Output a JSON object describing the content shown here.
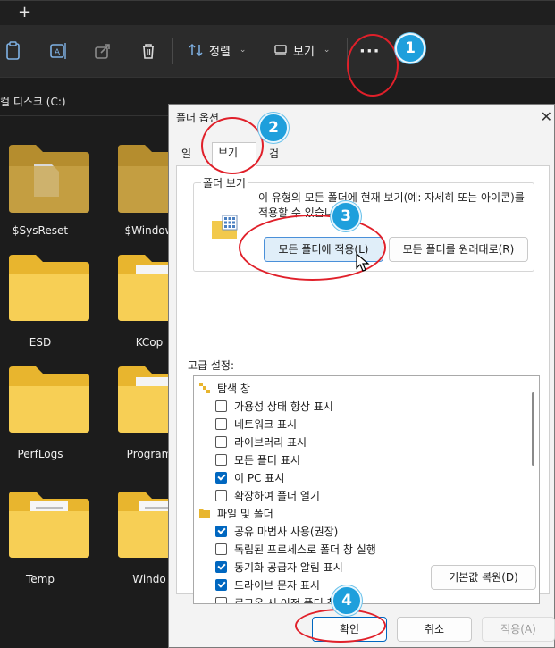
{
  "explorer": {
    "new_tab": "+",
    "toolbar": {
      "sort_label": "정렬",
      "view_label": "보기",
      "more_label": "···"
    },
    "address": "컬 디스크 (C:)",
    "folders": [
      {
        "label": "$SysReset"
      },
      {
        "label": "$Window"
      },
      {
        "label": "ESD"
      },
      {
        "label": "KCop"
      },
      {
        "label": "PerfLogs"
      },
      {
        "label": "Program"
      },
      {
        "label": "Temp"
      },
      {
        "label": "Windo"
      }
    ]
  },
  "dialog": {
    "title": "폴더 옵션",
    "close": "✕",
    "tabs": [
      {
        "label": "일반"
      },
      {
        "label": "보기"
      },
      {
        "label": "검색"
      }
    ],
    "folder_view": {
      "legend": "폴더 보기",
      "description": "이 유형의 모든 폴더에 현재 보기(예: 자세히 또는 아이콘)를 적용할 수 있습니다.",
      "apply_all_label": "모든 폴더에 적용(L)",
      "reset_all_label": "모든 폴더를 원래대로(R)"
    },
    "advanced_label": "고급 설정:",
    "advanced_items": [
      {
        "label": "탐색 창",
        "group": true
      },
      {
        "label": "가용성 상태 항상 표시",
        "checked": false
      },
      {
        "label": "네트워크 표시",
        "checked": false
      },
      {
        "label": "라이브러리 표시",
        "checked": false
      },
      {
        "label": "모든 폴더 표시",
        "checked": false
      },
      {
        "label": "이 PC 표시",
        "checked": true
      },
      {
        "label": "확장하여 폴더 열기",
        "checked": false
      },
      {
        "label": "파일 및 폴더",
        "group": true
      },
      {
        "label": "공유 마법사 사용(권장)",
        "checked": true
      },
      {
        "label": "독립된 프로세스로 폴더 창 실행",
        "checked": false
      },
      {
        "label": "동기화 공급자 알림 표시",
        "checked": true
      },
      {
        "label": "드라이브 문자 표시",
        "checked": true
      },
      {
        "label": "로그온 시 이전 폴더 창 복원",
        "checked": false
      }
    ],
    "restore_defaults_label": "기본값 복원(D)",
    "ok_label": "확인",
    "cancel_label": "취소",
    "apply_label": "적용(A)"
  },
  "annotations": {
    "step1": "1",
    "step2": "2",
    "step3": "3",
    "step4": "4",
    "color": "#e0202a",
    "badge_color": "#1e9fdc"
  }
}
